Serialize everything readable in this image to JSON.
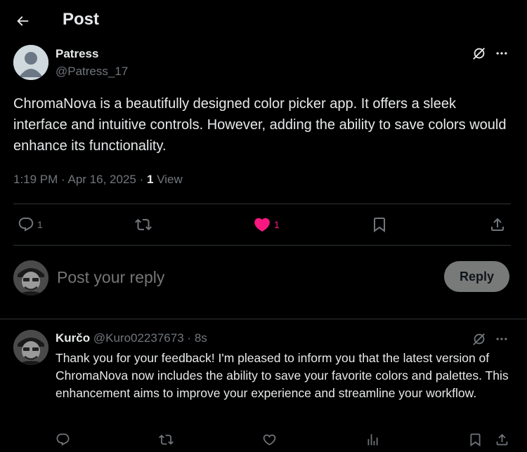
{
  "header": {
    "title": "Post"
  },
  "post": {
    "author_name": "Patress",
    "author_handle": "@Patress_17",
    "text": "ChromaNova is a beautifully designed color picker app. It offers a sleek interface and intuitive controls. However, adding the ability to save colors would enhance its functionality.",
    "time": "1:19 PM",
    "date": "Apr 16, 2025",
    "views_count": "1",
    "views_label": "View",
    "reply_count": "1",
    "repost_count": "",
    "like_count": "1",
    "liked": true
  },
  "composer": {
    "placeholder": "Post your reply",
    "reply_label": "Reply"
  },
  "reply": {
    "author_name": "Kurčo",
    "author_handle": "@Kuro02237673",
    "time": "8s",
    "text": "Thank you for your feedback! I'm pleased to inform you that the latest version of ChromaNova now includes the ability to save your favorite colors and palettes. This enhancement aims to improve your experience and streamline your workflow."
  },
  "icons": {
    "back": "arrow-left-icon",
    "grok": "grok-icon",
    "more": "more-icon",
    "reply": "comment-icon",
    "repost": "repost-icon",
    "like": "heart-icon",
    "bookmark": "bookmark-icon",
    "share": "share-icon",
    "analytics": "analytics-icon"
  },
  "colors": {
    "background": "#000000",
    "text": "#e7e9ea",
    "secondary": "#71767b",
    "like": "#f91880",
    "divider": "#2f3336",
    "reply_button": "#787a7a"
  }
}
